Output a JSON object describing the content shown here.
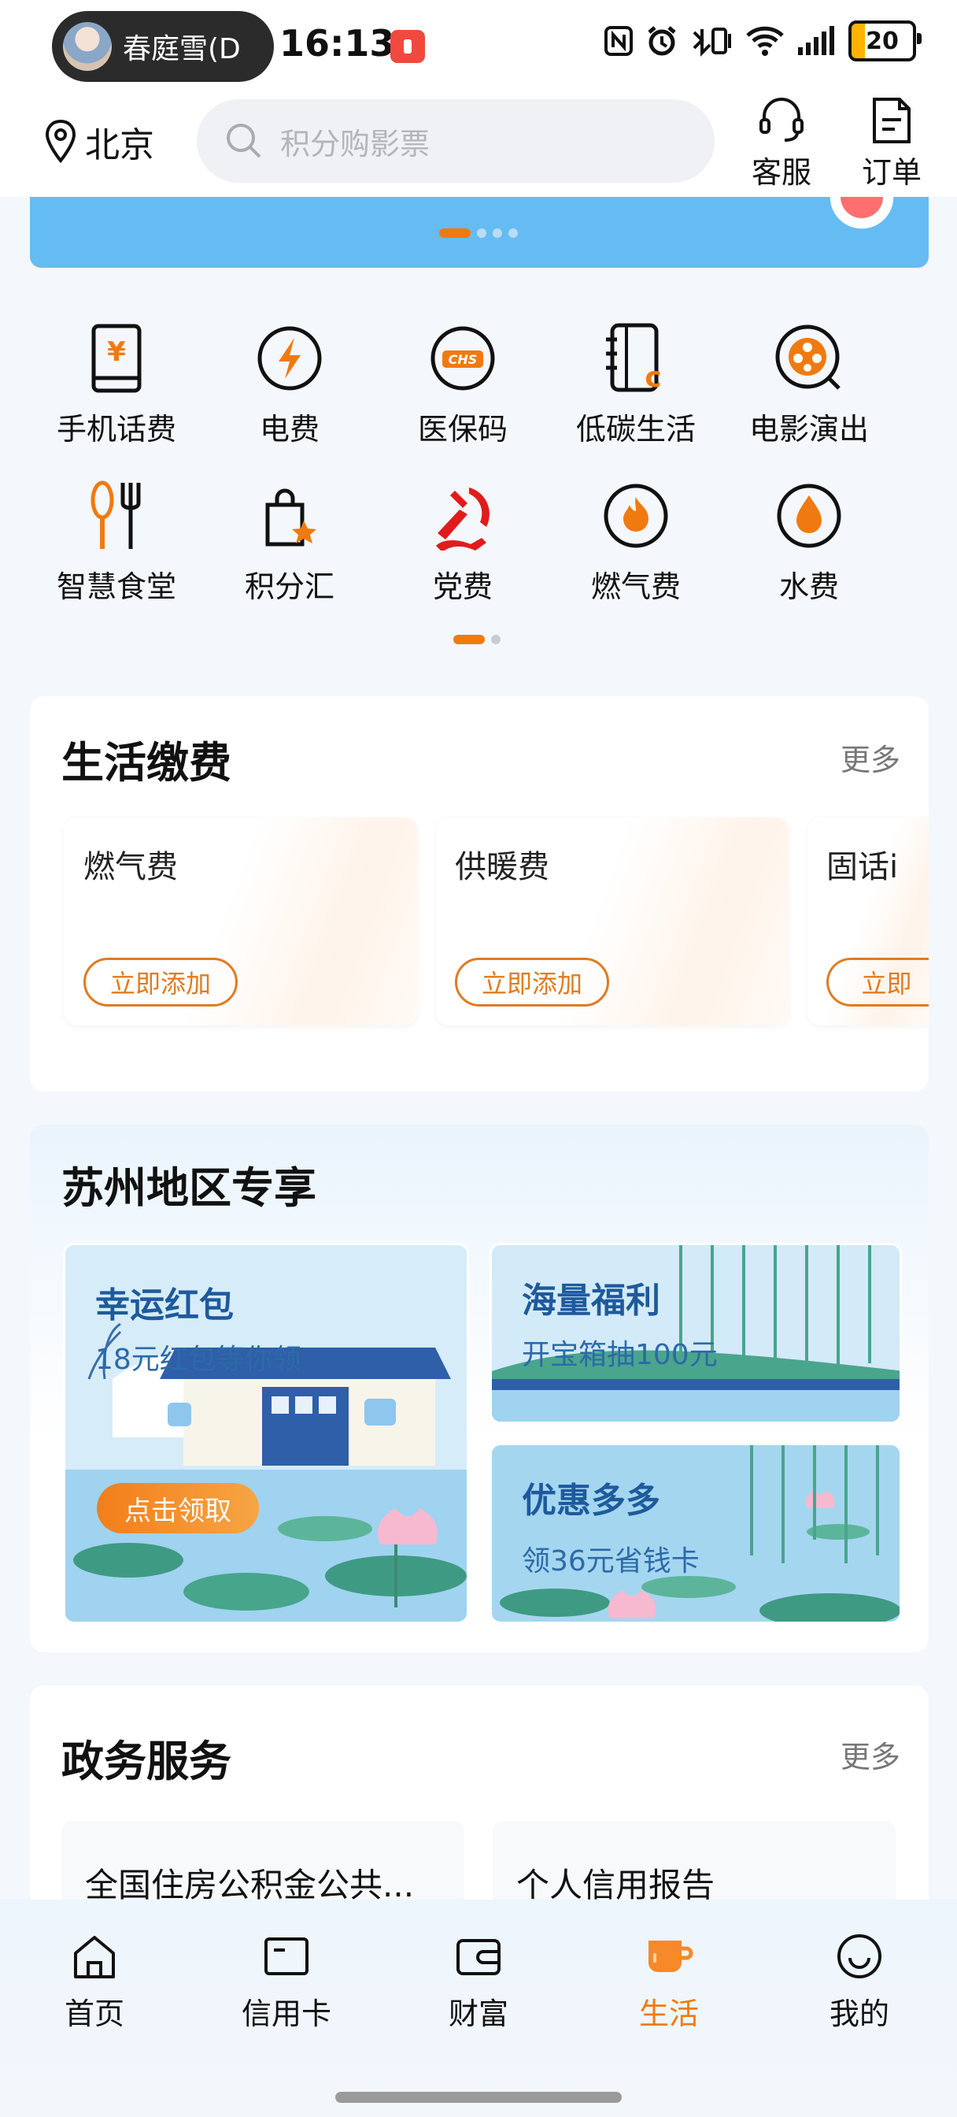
{
  "status_bar": {
    "user_name": "春庭雪(D",
    "time": "16:13",
    "battery": "20"
  },
  "header": {
    "location": "北京",
    "search_placeholder": "积分购影票",
    "service_label": "客服",
    "orders_label": "订单"
  },
  "quick_grid": {
    "items": [
      {
        "label": "手机话费",
        "icon": "phone-bill-icon"
      },
      {
        "label": "电费",
        "icon": "electricity-icon"
      },
      {
        "label": "医保码",
        "icon": "medical-insurance-icon"
      },
      {
        "label": "低碳生活",
        "icon": "low-carbon-icon"
      },
      {
        "label": "电影演出",
        "icon": "film-reel-icon"
      },
      {
        "label": "智慧食堂",
        "icon": "cutlery-icon"
      },
      {
        "label": "积分汇",
        "icon": "points-bag-icon"
      },
      {
        "label": "党费",
        "icon": "party-fee-icon"
      },
      {
        "label": "燃气费",
        "icon": "gas-flame-icon"
      },
      {
        "label": "水费",
        "icon": "water-drop-icon"
      }
    ]
  },
  "life_payment": {
    "title": "生活缴费",
    "more": "更多",
    "items": [
      {
        "label": "燃气费",
        "action": "立即添加"
      },
      {
        "label": "供暖费",
        "action": "立即添加"
      },
      {
        "label": "固话i",
        "action": "立即"
      }
    ]
  },
  "suzhou": {
    "title": "苏州地区专享",
    "tiles": [
      {
        "title": "幸运红包",
        "subtitle": "18元红包等你领",
        "button": "点击领取"
      },
      {
        "title": "海量福利",
        "subtitle": "开宝箱抽100元"
      },
      {
        "title": "优惠多多",
        "subtitle": "领36元省钱卡"
      }
    ]
  },
  "gov": {
    "title": "政务服务",
    "more": "更多",
    "items": [
      {
        "label": "全国住房公积金公共..."
      },
      {
        "label": "个人信用报告"
      }
    ]
  },
  "bottom_nav": {
    "items": [
      {
        "label": "首页",
        "icon": "home-icon"
      },
      {
        "label": "信用卡",
        "icon": "credit-card-icon"
      },
      {
        "label": "财富",
        "icon": "wallet-icon"
      },
      {
        "label": "生活",
        "icon": "cup-icon"
      },
      {
        "label": "我的",
        "icon": "smile-icon"
      }
    ],
    "active": "生活",
    "accent_color": "#f07a10"
  }
}
